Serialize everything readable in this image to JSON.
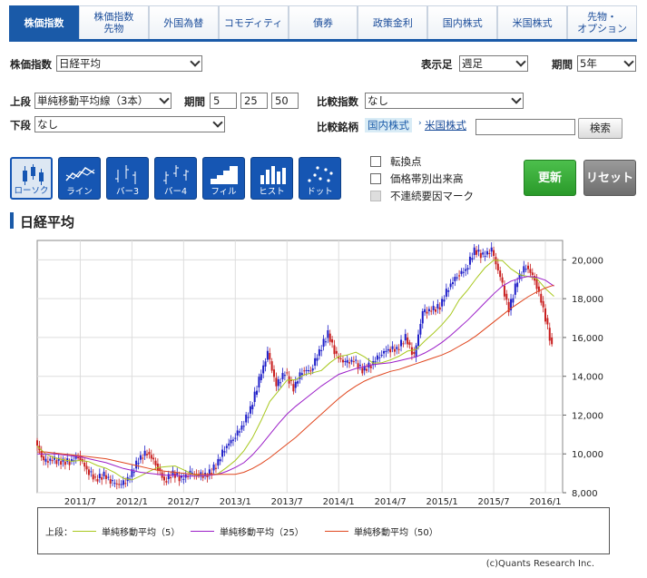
{
  "tabs": [
    {
      "label": "株価指数",
      "active": true
    },
    {
      "label": "株価指数\n先物",
      "active": false
    },
    {
      "label": "外国為替",
      "active": false
    },
    {
      "label": "コモディティ",
      "active": false
    },
    {
      "label": "債券",
      "active": false
    },
    {
      "label": "政策金利",
      "active": false
    },
    {
      "label": "国内株式",
      "active": false
    },
    {
      "label": "米国株式",
      "active": false
    },
    {
      "label": "先物・\nオプション",
      "active": false
    }
  ],
  "form": {
    "index_label": "株価指数",
    "index_value": "日経平均",
    "display_label": "表示足",
    "display_value": "週足",
    "period_label": "期間",
    "period_value": "5年",
    "upper_label": "上段",
    "upper_value": "単純移動平均線（3本）",
    "term_label": "期間",
    "term_values": [
      "5",
      "25",
      "50"
    ],
    "lower_label": "下段",
    "lower_value": "なし",
    "compare_index_label": "比較指数",
    "compare_index_value": "なし",
    "compare_stock_label": "比較銘柄",
    "compare_tabs": [
      "国内株式",
      "米国株式"
    ],
    "search_value": "",
    "search_button": "検索"
  },
  "chart_types": [
    {
      "label": "ローソク",
      "icon": "candlestick-icon",
      "active": true
    },
    {
      "label": "ライン",
      "icon": "line-chart-icon",
      "active": false
    },
    {
      "label": "バー3",
      "icon": "bar3-icon",
      "active": false
    },
    {
      "label": "バー4",
      "icon": "bar4-icon",
      "active": false
    },
    {
      "label": "フィル",
      "icon": "fill-chart-icon",
      "active": false
    },
    {
      "label": "ヒスト",
      "icon": "histogram-icon",
      "active": false
    },
    {
      "label": "ドット",
      "icon": "dot-chart-icon",
      "active": false
    }
  ],
  "options": [
    {
      "label": "転換点",
      "checked": false,
      "disabled": false
    },
    {
      "label": "価格帯別出来高",
      "checked": false,
      "disabled": false
    },
    {
      "label": "不連続要因マーク",
      "checked": false,
      "disabled": true
    }
  ],
  "buttons": {
    "update": "更新",
    "reset": "リセット"
  },
  "chart_title": "日経平均",
  "legend": {
    "label": "上段：",
    "items": [
      {
        "name": "単純移動平均（5）",
        "color": "#a8c81e"
      },
      {
        "name": "単純移動平均（25）",
        "color": "#9b1ec8"
      },
      {
        "name": "単純移動平均（50）",
        "color": "#e0461e"
      }
    ]
  },
  "copyright": "(c)Quants Research Inc.",
  "colors": {
    "up": "#1e1ec8",
    "down": "#c81e1e",
    "accent": "#1a5aa8"
  },
  "chart_data": {
    "type": "line",
    "x_ticks": [
      "2011/7",
      "2012/1",
      "2012/7",
      "2013/1",
      "2013/7",
      "2014/1",
      "2014/7",
      "2015/1",
      "2015/7",
      "2016/1"
    ],
    "y_ticks": [
      8000,
      10000,
      12000,
      14000,
      16000,
      18000,
      20000
    ],
    "y_tick_labels": [
      "8,000",
      "10,000",
      "12,000",
      "14,000",
      "16,000",
      "18,000",
      "20,000"
    ],
    "ylim": [
      8000,
      21000
    ],
    "x_start": "2011/2",
    "x_end": "2016/3",
    "grid": true,
    "series": [
      {
        "name": "日経平均",
        "x": [
          "2011/2",
          "2011/3",
          "2011/4",
          "2011/5",
          "2011/6",
          "2011/7",
          "2011/8",
          "2011/9",
          "2011/10",
          "2011/11",
          "2011/12",
          "2012/1",
          "2012/2",
          "2012/3",
          "2012/4",
          "2012/5",
          "2012/6",
          "2012/7",
          "2012/8",
          "2012/9",
          "2012/10",
          "2012/11",
          "2012/12",
          "2013/1",
          "2013/2",
          "2013/3",
          "2013/4",
          "2013/5",
          "2013/6",
          "2013/7",
          "2013/8",
          "2013/9",
          "2013/10",
          "2013/11",
          "2013/12",
          "2014/1",
          "2014/2",
          "2014/3",
          "2014/4",
          "2014/5",
          "2014/6",
          "2014/7",
          "2014/8",
          "2014/9",
          "2014/10",
          "2014/11",
          "2014/12",
          "2015/1",
          "2015/2",
          "2015/3",
          "2015/4",
          "2015/5",
          "2015/6",
          "2015/7",
          "2015/8",
          "2015/9",
          "2015/10",
          "2015/11",
          "2015/12",
          "2016/1",
          "2016/2"
        ],
        "values": [
          10700,
          9600,
          9700,
          9600,
          9600,
          9900,
          9200,
          8700,
          8900,
          8500,
          8400,
          8800,
          9700,
          10100,
          9500,
          8600,
          9000,
          8700,
          9000,
          8900,
          8900,
          9400,
          10300,
          10800,
          11400,
          12300,
          13800,
          15200,
          13500,
          14200,
          13400,
          14300,
          14300,
          15300,
          16200,
          15000,
          14700,
          14800,
          14300,
          14600,
          15100,
          15400,
          15400,
          16000,
          15000,
          17300,
          17400,
          17600,
          18600,
          19200,
          19500,
          20500,
          20200,
          20500,
          19100,
          17400,
          19000,
          19700,
          19000,
          17500,
          15500
        ]
      },
      {
        "name": "単純移動平均（5）",
        "values": [
          10400,
          10000,
          9800,
          9700,
          9620,
          9660,
          9600,
          9400,
          9260,
          9040,
          8740,
          8660,
          8860,
          9100,
          9300,
          9340,
          9380,
          9180,
          8960,
          8840,
          8900,
          8980,
          9300,
          9660,
          10160,
          10840,
          11720,
          12700,
          13240,
          13800,
          13820,
          14080,
          14180,
          14300,
          14700,
          15020,
          15100,
          15240,
          15000,
          14680,
          14700,
          14840,
          15040,
          15300,
          15380,
          15820,
          16220,
          16660,
          17180,
          17940,
          18460,
          19060,
          19600,
          19980,
          19960,
          19540,
          19240,
          19140,
          19040,
          18520,
          18120
        ]
      },
      {
        "name": "単純移動平均（25）",
        "values": [
          10000,
          10000,
          10000,
          9950,
          9900,
          9850,
          9750,
          9650,
          9550,
          9400,
          9250,
          9150,
          9050,
          9000,
          8950,
          8900,
          8900,
          8850,
          8850,
          8850,
          8900,
          8950,
          9100,
          9300,
          9550,
          9950,
          10450,
          11000,
          11550,
          12050,
          12450,
          12800,
          13150,
          13500,
          13800,
          14100,
          14250,
          14400,
          14500,
          14600,
          14650,
          14700,
          14800,
          14900,
          15000,
          15200,
          15450,
          15750,
          16100,
          16500,
          16900,
          17350,
          17800,
          18250,
          18650,
          18900,
          19050,
          19150,
          19100,
          18950,
          18650
        ]
      },
      {
        "name": "単純移動平均（50）",
        "values": [
          10100,
          10100,
          10050,
          10000,
          9950,
          9900,
          9850,
          9800,
          9750,
          9650,
          9550,
          9450,
          9350,
          9250,
          9150,
          9100,
          9050,
          9000,
          8950,
          8950,
          8950,
          8950,
          8950,
          8950,
          9050,
          9250,
          9500,
          9800,
          10150,
          10500,
          10850,
          11250,
          11650,
          12050,
          12450,
          12850,
          13200,
          13500,
          13750,
          13950,
          14100,
          14250,
          14350,
          14500,
          14650,
          14800,
          14950,
          15100,
          15300,
          15550,
          15800,
          16100,
          16450,
          16800,
          17150,
          17500,
          17800,
          18100,
          18350,
          18550,
          18700
        ]
      }
    ]
  }
}
